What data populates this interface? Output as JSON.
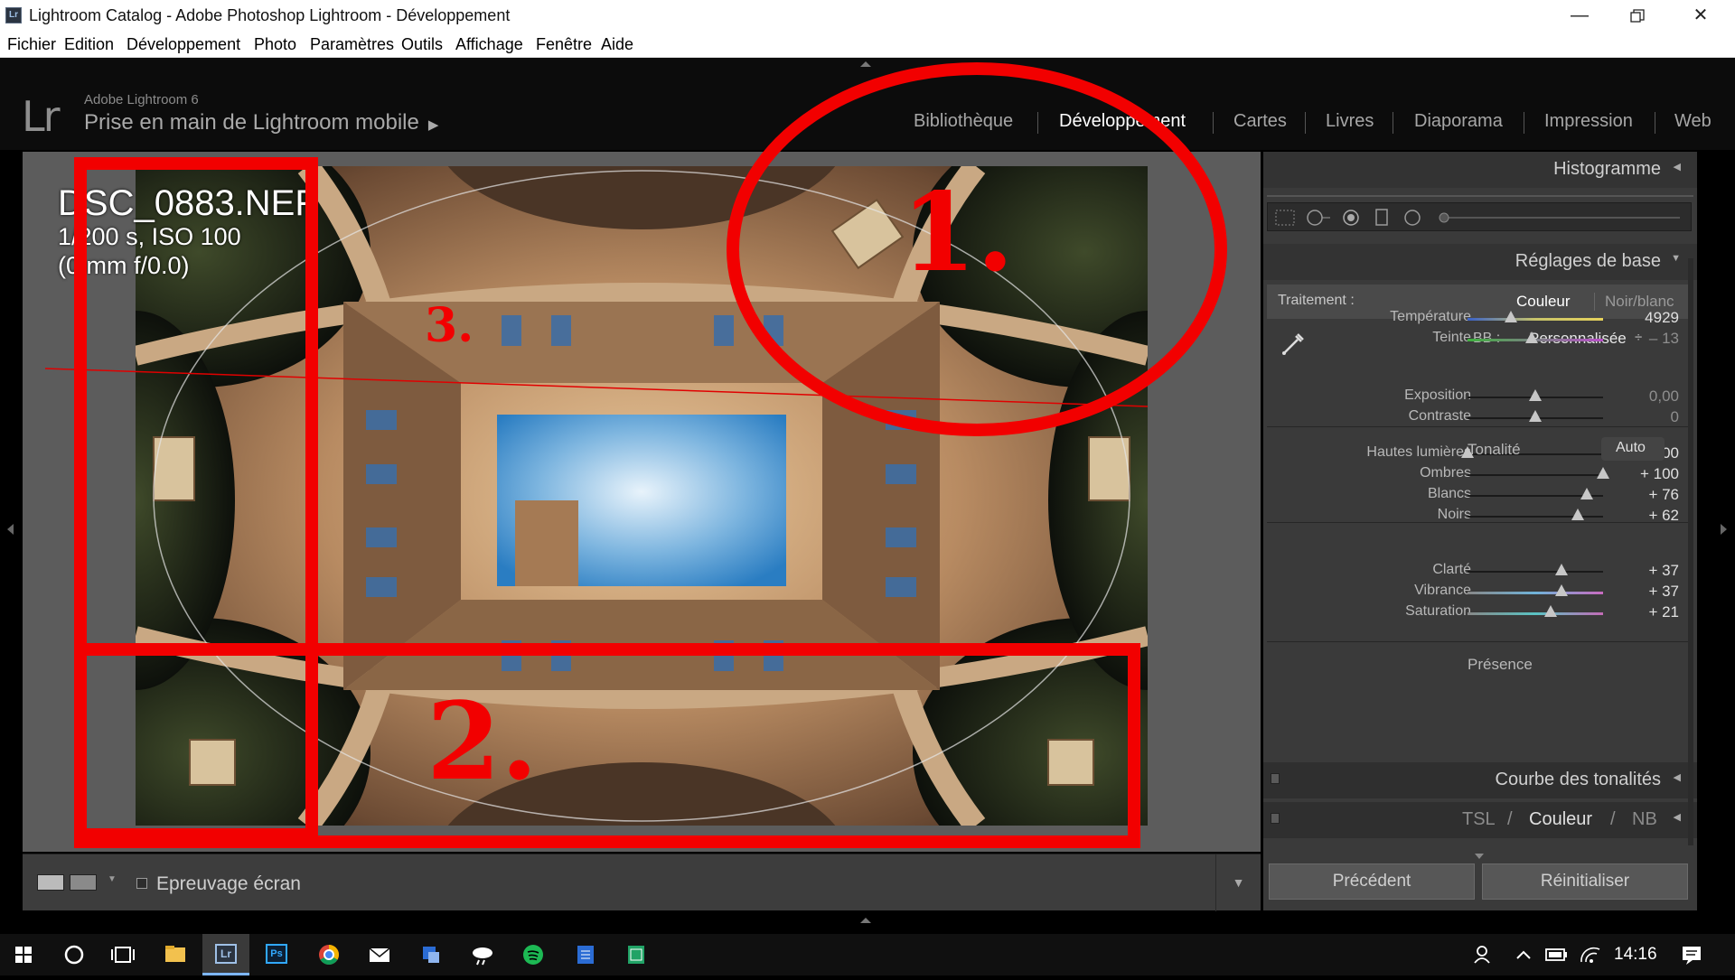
{
  "window": {
    "app_icon": "Lr",
    "title": "Lightroom Catalog - Adobe Photoshop Lightroom - Développement",
    "controls": [
      "minimize-icon",
      "restore-icon",
      "close-icon"
    ]
  },
  "menu": [
    "Fichier",
    "Edition",
    "Développement",
    "Photo",
    "Paramètres",
    "Outils",
    "Affichage",
    "Fenêtre",
    "Aide"
  ],
  "header": {
    "logo": "Lr",
    "version": "Adobe Lightroom 6",
    "identity_plate": "Prise en main de Lightroom mobile",
    "modules": [
      "Bibliothèque",
      "Développement",
      "Cartes",
      "Livres",
      "Diaporama",
      "Impression",
      "Web"
    ],
    "active_module": "Développement"
  },
  "photo_info": {
    "filename": "DSC_0883.NEF",
    "exposure": "1/200 s, ISO 100",
    "lens": "(0 mm f/0.0)"
  },
  "toolbar": {
    "proof_label": "Epreuvage écran",
    "proof_checked": false
  },
  "panel": {
    "histogram_title": "Histogramme",
    "basic_title": "Réglages de base",
    "treatment_label": "Traitement :",
    "treatment_color": "Couleur",
    "treatment_bw": "Noir/blanc",
    "wb_label": "BB :",
    "wb_value": "Personnalisée",
    "wb_arrows": "÷",
    "tone_label": "Tonalité",
    "auto_label": "Auto",
    "presence_label": "Présence",
    "sliders": [
      {
        "label": "Température",
        "value": "4929",
        "level": 0.32
      },
      {
        "label": "Teinte",
        "value": "– 13",
        "level": 0.47
      },
      {
        "label": "Exposition",
        "value": "0,00",
        "level": 0.5
      },
      {
        "label": "Contraste",
        "value": "0",
        "level": 0.5
      },
      {
        "label": "Hautes lumières",
        "value": "– 100",
        "level": 0.0
      },
      {
        "label": "Ombres",
        "value": "+ 100",
        "level": 1.0
      },
      {
        "label": "Blancs",
        "value": "+ 76",
        "level": 0.88
      },
      {
        "label": "Noirs",
        "value": "+ 62",
        "level": 0.81
      },
      {
        "label": "Clarté",
        "value": "+ 37",
        "level": 0.69
      },
      {
        "label": "Vibrance",
        "value": "+ 37",
        "level": 0.69
      },
      {
        "label": "Saturation",
        "value": "+ 21",
        "level": 0.61
      }
    ],
    "tone_curve_title": "Courbe des tonalités",
    "hsl_tsl": "TSL",
    "hsl_sep": "/",
    "hsl_color": "Couleur",
    "hsl_nb": "NB",
    "previous_button": "Précédent",
    "reset_button": "Réinitialiser"
  },
  "annotations": [
    "1.",
    "1.",
    "2.",
    "2.",
    "3.",
    "3."
  ],
  "taskbar": {
    "apps": [
      "windows-start-icon",
      "cortana-icon",
      "task-view-icon",
      "file-explorer-icon",
      "lightroom-icon",
      "photoshop-icon",
      "chrome-icon",
      "mail-icon",
      "app-icon",
      "weather-icon",
      "spotify-icon",
      "word-icon",
      "excel-icon"
    ],
    "photoshop_label": "Ps",
    "lightroom_label": "Lr",
    "tray": [
      "people-icon",
      "chevron-up-icon",
      "battery-icon",
      "wifi-icon"
    ],
    "clock": "14:16"
  },
  "colors": {
    "annotation_red": "#f20000",
    "panel_bg": "#3a3a3a",
    "center_bg": "#5c5c5c"
  }
}
